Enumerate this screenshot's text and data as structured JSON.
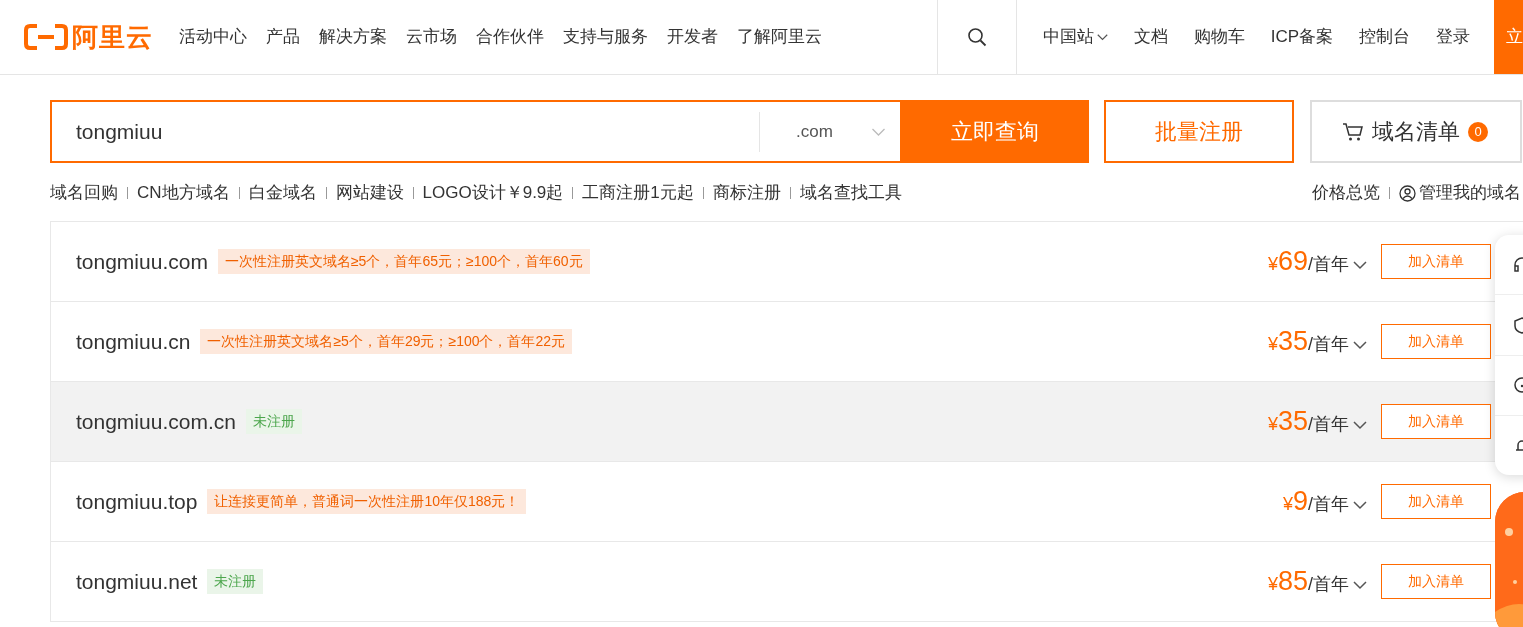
{
  "header": {
    "logo_text": "阿里云",
    "nav": [
      "活动中心",
      "产品",
      "解决方案",
      "云市场",
      "合作伙伴",
      "支持与服务",
      "开发者",
      "了解阿里云"
    ],
    "site_selector": "中国站",
    "links": [
      "文档",
      "购物车",
      "ICP备案",
      "控制台",
      "登录"
    ],
    "cta": "立"
  },
  "search": {
    "value": "tongmiuu",
    "suffix": ".com",
    "submit": "立即查询",
    "bulk": "批量注册",
    "cart": {
      "label": "域名清单",
      "count": "0"
    }
  },
  "quick_links": [
    "域名回购",
    "CN地方域名",
    "白金域名",
    "网站建设",
    "LOGO设计￥9.9起",
    "工商注册1元起",
    "商标注册",
    "域名查找工具"
  ],
  "right_links": {
    "price": "价格总览",
    "manage": "管理我的域名"
  },
  "results": [
    {
      "domain": "tongmiuu.com",
      "tag": {
        "kind": "promo",
        "text": "一次性注册英文域名≥5个，首年65元；≥100个，首年60元"
      },
      "currency": "¥",
      "price": "69",
      "unit": "/首年",
      "button": "加入清单",
      "hovered": false
    },
    {
      "domain": "tongmiuu.cn",
      "tag": {
        "kind": "promo",
        "text": "一次性注册英文域名≥5个，首年29元；≥100个，首年22元"
      },
      "currency": "¥",
      "price": "35",
      "unit": "/首年",
      "button": "加入清单",
      "hovered": false
    },
    {
      "domain": "tongmiuu.com.cn",
      "tag": {
        "kind": "status",
        "text": "未注册"
      },
      "currency": "¥",
      "price": "35",
      "unit": "/首年",
      "button": "加入清单",
      "hovered": true
    },
    {
      "domain": "tongmiuu.top",
      "tag": {
        "kind": "promo",
        "text": "让连接更简单，普通词一次性注册10年仅188元！"
      },
      "currency": "¥",
      "price": "9",
      "unit": "/首年",
      "button": "加入清单",
      "hovered": false
    },
    {
      "domain": "tongmiuu.net",
      "tag": {
        "kind": "status",
        "text": "未注册"
      },
      "currency": "¥",
      "price": "85",
      "unit": "/首年",
      "button": "加入清单",
      "hovered": false
    }
  ]
}
